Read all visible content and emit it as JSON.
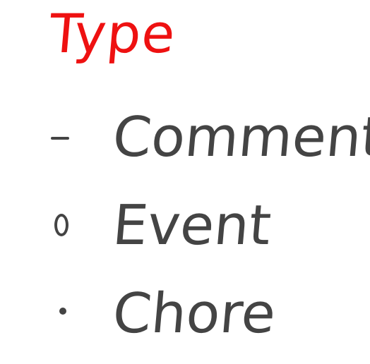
{
  "title": "Type",
  "colors": {
    "title": "#ee1111",
    "text": "#444444",
    "background": "#ffffff"
  },
  "items": [
    {
      "marker_icon": "dash-icon",
      "label": "Comment"
    },
    {
      "marker_icon": "circle-icon",
      "label": "Event"
    },
    {
      "marker_icon": "bullet-icon",
      "label": "Chore"
    }
  ]
}
